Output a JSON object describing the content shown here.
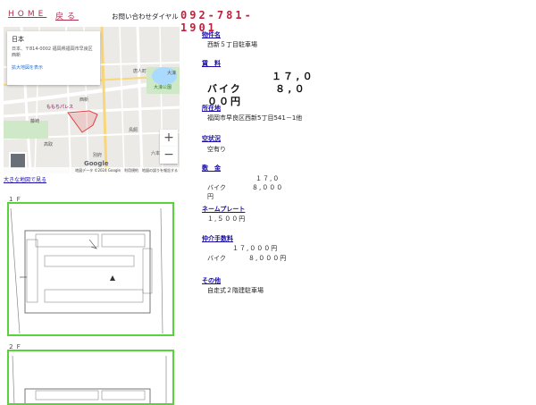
{
  "header": {
    "home_label": "HOME",
    "back_label": "戻る",
    "contact_label": "お問い合わせダイヤル",
    "phone": "092-781-1901"
  },
  "map": {
    "card_title": "日本",
    "card_address": "日本、〒814-0002 福岡県福岡市早良区西新",
    "card_link": "拡大地図を表示",
    "zoom_in": "+",
    "zoom_out": "−",
    "google_logo": "Google",
    "attribution": "地図データ ©2024 Google　利用規約　地図の誤りを報告する",
    "place_labels": [
      "唐人町",
      "大濠",
      "藤崎",
      "西新",
      "高取",
      "六本松",
      "ももちパレス",
      "大濠公園",
      "鳥飼",
      "別府"
    ],
    "big_map_link": "大きな地図で見る"
  },
  "floors": [
    {
      "label": "１Ｆ"
    },
    {
      "label": "２Ｆ"
    }
  ],
  "details": {
    "name": {
      "label": "物件名",
      "value": "西新５丁目駐車場"
    },
    "rent": {
      "label": "賃　料",
      "car_amount": "１７,０",
      "bike_amount": "８,０",
      "overlap_text": "バイク",
      "yen": "００円"
    },
    "address": {
      "label": "所在地",
      "value": "福岡市早良区西新5丁目541－1他"
    },
    "vacancy": {
      "label": "空状況",
      "value": "空有り"
    },
    "deposit": {
      "label": "敷　金",
      "car_amount": "１７,０",
      "overlap_text": "バイク",
      "bike_amount": "８,０００",
      "yen": "円"
    },
    "nameplate": {
      "label": "ネームプレート",
      "value": "１,５００円"
    },
    "brokerage": {
      "label": "仲介手数料",
      "car_value": "１７,０００円",
      "bike_label": "バイク",
      "bike_value": "８,０００円"
    },
    "other": {
      "label": "その他",
      "value": "自走式２階建駐車場"
    }
  }
}
